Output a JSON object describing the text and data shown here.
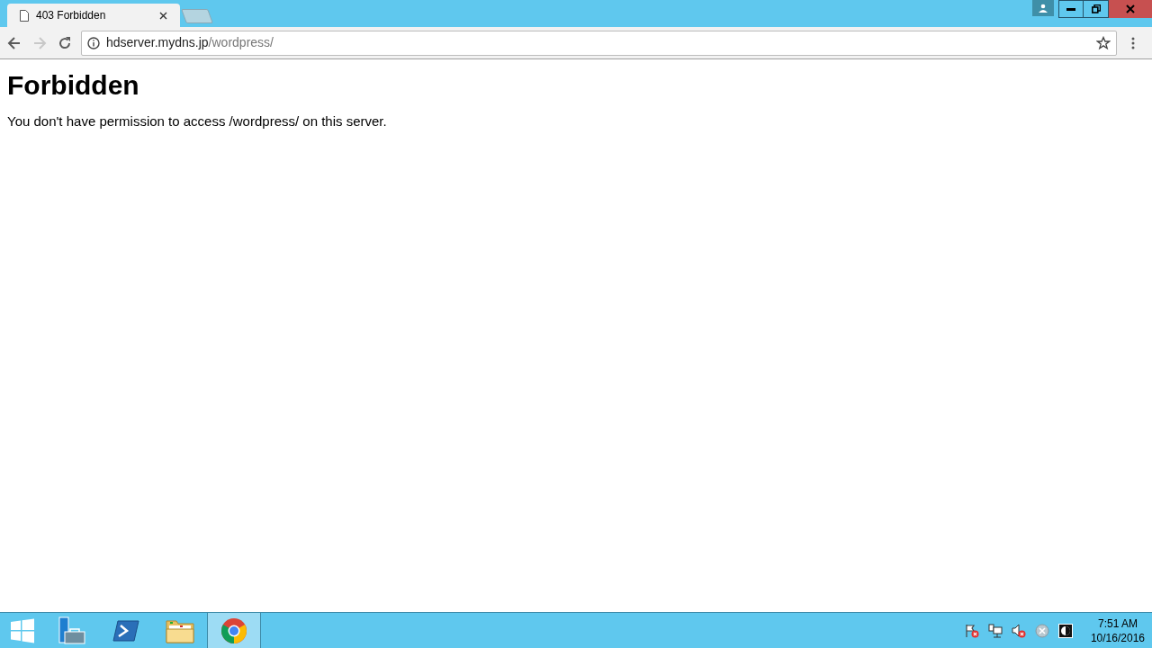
{
  "tabs": [
    {
      "title": "403 Forbidden",
      "selected": true
    }
  ],
  "address": {
    "host": "hdserver.mydns.jp",
    "path": "/wordpress/"
  },
  "page": {
    "heading": "Forbidden",
    "message": "You don't have permission to access /wordpress/ on this server."
  },
  "taskbar": {
    "apps": [
      {
        "kind": "server-manager",
        "selected": false
      },
      {
        "kind": "powershell",
        "selected": false
      },
      {
        "kind": "explorer",
        "selected": false
      },
      {
        "kind": "chrome",
        "selected": true
      }
    ],
    "clock": {
      "time": "7:51 AM",
      "date": "10/16/2016"
    }
  }
}
